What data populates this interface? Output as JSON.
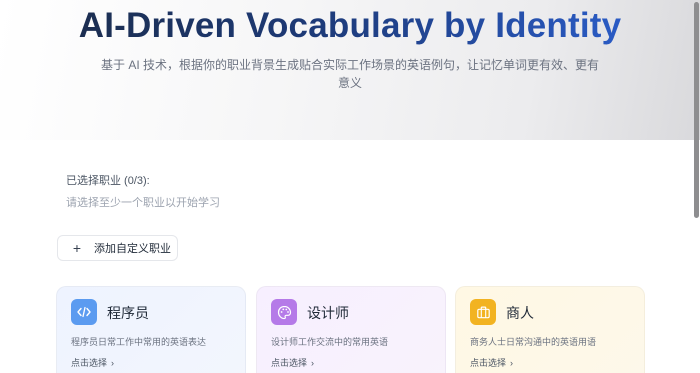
{
  "hero": {
    "title": "AI-Driven Vocabulary by Identity",
    "subtitle": "基于 AI 技术，根据你的职业背景生成贴合实际工作场景的英语例句，让记忆单词更有效、更有意义"
  },
  "selection": {
    "label": "已选择职业 (0/3):",
    "hint": "请选择至少一个职业以开始学习"
  },
  "actions": {
    "add_custom_label": "添加自定义职业",
    "add_icon": "plus-icon"
  },
  "cards": [
    {
      "title": "程序员",
      "description": "程序员日常工作中常用的英语表达",
      "cta": "点击选择",
      "icon": "code-icon",
      "color": "#5b9bf0"
    },
    {
      "title": "设计师",
      "description": "设计师工作交流中的常用英语",
      "cta": "点击选择",
      "icon": "palette-icon",
      "color": "#b57ae8"
    },
    {
      "title": "商人",
      "description": "商务人士日常沟通中的英语用语",
      "cta": "点击选择",
      "icon": "briefcase-icon",
      "color": "#f2b321"
    }
  ],
  "colors": {
    "title_gradient_start": "#1b2a44",
    "title_gradient_end": "#2d63d8"
  }
}
